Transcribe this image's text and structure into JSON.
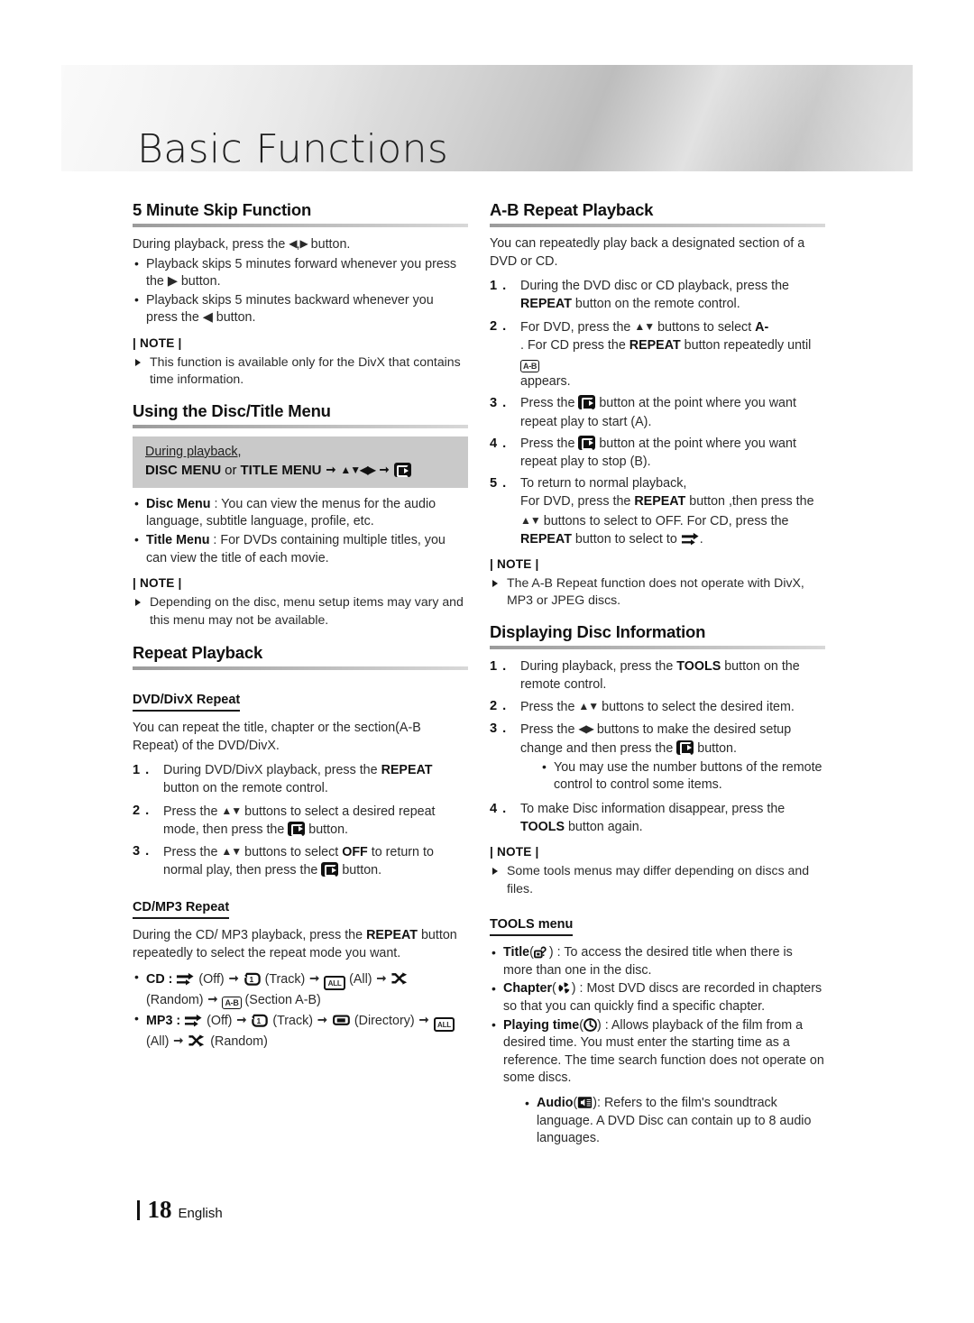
{
  "page": {
    "chapter_title": "Basic Functions",
    "page_number": "18",
    "language": "English"
  },
  "left_column": {
    "skip": {
      "heading": "5 Minute Skip Function",
      "intro_a": "During playback, press the ",
      "intro_b": ",",
      "intro_c": " button.",
      "bullets": [
        "Playback skips 5 minutes forward whenever you press the ▶ button.",
        "Playback skips 5 minutes backward whenever you press the ◀ button."
      ],
      "note_label": "| NOTE |",
      "notes": [
        "This function is available only for the DivX that contains time information."
      ]
    },
    "disc_title_menu": {
      "heading": "Using the Disc/Title Menu",
      "callout_line1": "During playback,",
      "callout_disc": "DISC MENU",
      "callout_or": "or",
      "callout_title": "TITLE MENU",
      "bullets": [
        {
          "term": "Disc Menu",
          "text": " : You can view the menus for the audio language, subtitle language, profile, etc."
        },
        {
          "term": "Title Menu",
          "text": " : For DVDs containing multiple titles, you can view the title of each movie."
        }
      ],
      "note_label": "| NOTE |",
      "notes": [
        "Depending on the disc, menu setup items may vary and this menu may not be available."
      ]
    },
    "repeat_playback": {
      "heading": "Repeat Playback",
      "dvd_divx": {
        "subheading": "DVD/DivX Repeat",
        "intro": "You can repeat the title, chapter or the section(A-B Repeat) of the DVD/DivX.",
        "step1_a": "During DVD/DivX playback, press the ",
        "step1_key": "REPEAT",
        "step1_b": "button on the remote control.",
        "step2_a": "Press the ",
        "step2_b": " buttons to select a desired repeat mode, then press the ",
        "step2_c": " button.",
        "step3_a": "Press the ",
        "step3_b": " buttons to select ",
        "step3_key": "OFF",
        "step3_c": " to return to normal play, then press the ",
        "step3_d": " button."
      },
      "cd_mp3": {
        "subheading": "CD/MP3 Repeat",
        "intro_a": "During the CD/ MP3 playback, press the ",
        "intro_key": "REPEAT",
        "intro_b": " button repeatedly to select the repeat mode you want.",
        "cd_label": "CD :",
        "cd_seq": [
          "(Off)",
          "(Track)",
          "(All)",
          "(Random)",
          "(Section A-B)"
        ],
        "mp3_label": "MP3 :",
        "mp3_seq": [
          "(Off)",
          "(Track)",
          "(Directory)",
          "(All)",
          "(Random)"
        ]
      }
    }
  },
  "right_column": {
    "ab_repeat": {
      "heading": "A-B Repeat Playback",
      "intro": "You can repeatedly play back a designated section of a DVD or CD.",
      "step1_a": "During the DVD disc or CD playback, press the ",
      "step1_key": "REPEAT",
      "step1_b": " button on the remote control.",
      "step2_a": "For DVD, press the ",
      "step2_b": " buttons to select ",
      "step2_key": "A-",
      "step2_c": ". For CD press the ",
      "step2_key2": "REPEAT",
      "step2_d": " button repeatedly until ",
      "step2_e": "appears.",
      "step3_a": "Press the ",
      "step3_b": " button at the point where you want repeat play to start (A).",
      "step4_a": "Press the ",
      "step4_b": " button at the point where you want repeat play to stop (B).",
      "step5_a": "To return to normal playback,",
      "step5_b": "For DVD, press the ",
      "step5_key": "REPEAT",
      "step5_c": " button ,then press  the ",
      "step5_d": " buttons to select to OFF. For CD, press the ",
      "step5_key2": "REPEAT",
      "step5_e": " button to select to ",
      "step5_f": ".",
      "note_label": "| NOTE |",
      "notes": [
        "The A-B Repeat function does not operate with DivX, MP3 or JPEG discs."
      ]
    },
    "disc_info": {
      "heading": "Displaying Disc Information",
      "step1_a": "During playback, press the ",
      "step1_key": "TOOLS",
      "step1_b": " button on the remote control.",
      "step2_a": "Press the ",
      "step2_b": " buttons to select the desired item.",
      "step3_a": "Press the ",
      "step3_b": " buttons to make the desired setup change and then press the ",
      "step3_c": " button.",
      "step3_sub": "You may use the number buttons of the remote control to control some items.",
      "step4_a": "To make Disc information disappear, press the ",
      "step4_key": "TOOLS",
      "step4_b": " button again.",
      "note_label": "| NOTE |",
      "notes": [
        "Some tools menus may differ depending on discs and files."
      ]
    },
    "tools_menu": {
      "subheading": "TOOLS menu",
      "items": [
        {
          "term": "Title",
          "open": "(",
          "close": ") : ",
          "text": "To access the desired title when there is more than one in the disc."
        },
        {
          "term": "Chapter",
          "open": "(",
          "close": ") : ",
          "text": "Most DVD discs are recorded in chapters so that you can quickly find a specific chapter."
        },
        {
          "term": "Playing time",
          "open": "(",
          "close": ") : ",
          "text": "Allows playback of the film from a desired time. You must enter the starting time as a reference. The time search function does not operate on some discs."
        }
      ],
      "sub_item": {
        "term": "Audio",
        "open": "(",
        "close": "): ",
        "text": "Refers to the film's soundtrack language. A DVD Disc can contain up to 8 audio languages."
      }
    }
  },
  "icons": {
    "enter": "enter-icon",
    "ab": "a-b-icon",
    "all": "all-icon",
    "off": "off-repeat-icon",
    "track": "track-repeat-icon",
    "random": "random-shuffle-icon",
    "directory": "directory-icon",
    "title": "title-icon",
    "chapter": "chapter-icon",
    "clock": "playing-time-icon",
    "audio": "audio-icon"
  },
  "colors": {
    "text": "#2b2b2b",
    "heading": "#111111",
    "rule": "#9b9b9b",
    "callout_bg": "#c9c9c9",
    "banner_light": "#f3f3f3",
    "banner_dark": "#bcbcbc"
  }
}
